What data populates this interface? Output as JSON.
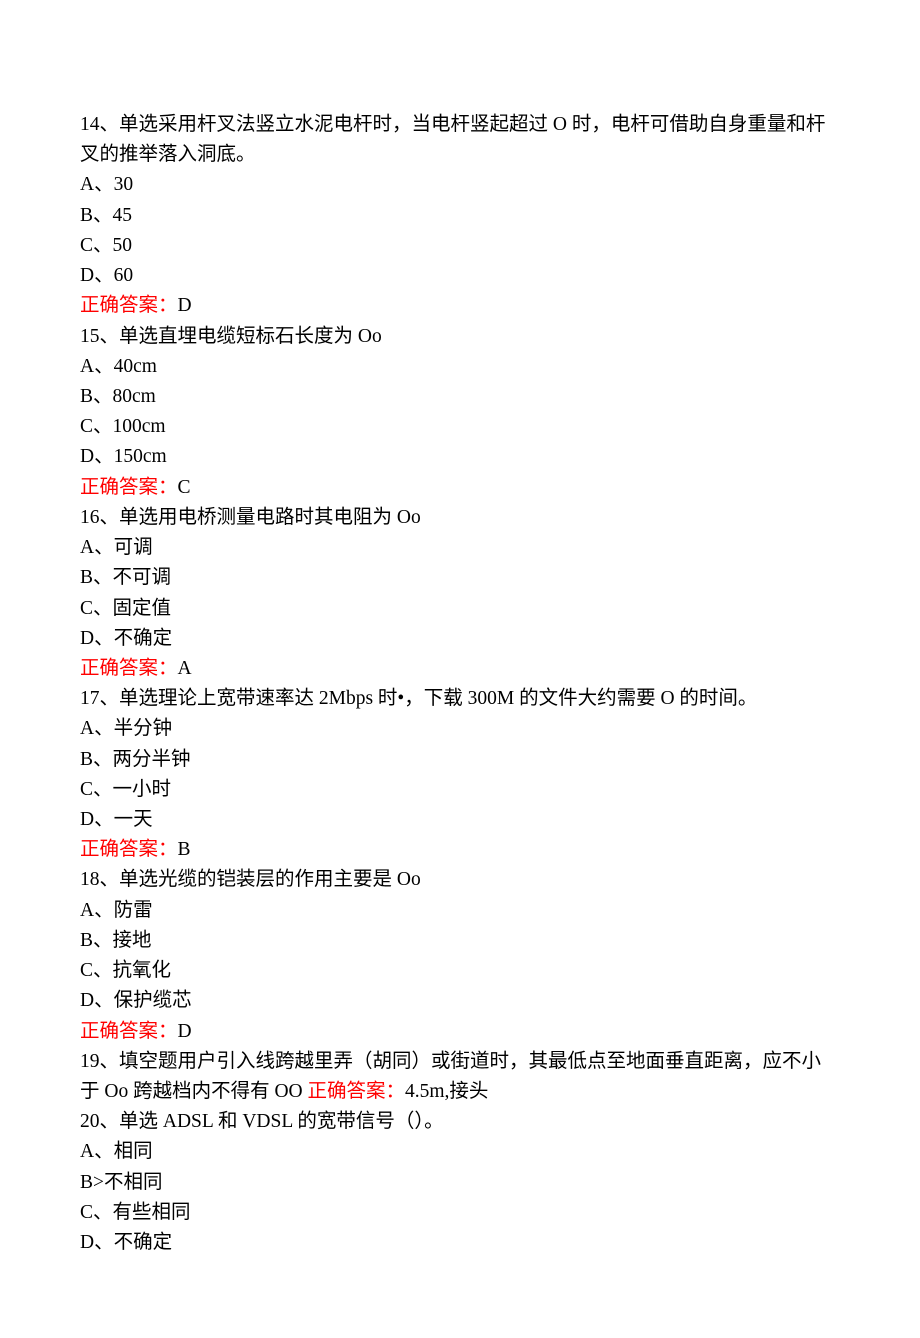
{
  "q14": {
    "text": "14、单选采用杆叉法竖立水泥电杆时，当电杆竖起超过 O 时，电杆可借助自身重量和杆叉的推举落入洞底。",
    "optA": "A、30",
    "optB": "B、45",
    "optC": "C、50",
    "optD": "D、60",
    "ansLabel": "正确答案：",
    "ansVal": "D"
  },
  "q15": {
    "text": "15、单选直埋电缆短标石长度为 Oo",
    "optA": "A、40cm",
    "optB": "B、80cm",
    "optC": "C、100cm",
    "optD": "D、150cm",
    "ansLabel": "正确答案：",
    "ansVal": "C"
  },
  "q16": {
    "text": "16、单选用电桥测量电路时其电阻为 Oo",
    "optA": "A、可调",
    "optB": "B、不可调",
    "optC": "C、固定值",
    "optD": "D、不确定",
    "ansLabel": "正确答案：",
    "ansVal": "A"
  },
  "q17": {
    "text": "17、单选理论上宽带速率达 2Mbps 时•，下载 300M 的文件大约需要 O 的时间。",
    "optA": "A、半分钟",
    "optB": "B、两分半钟",
    "optC": "C、一小时",
    "optD": "D、一天",
    "ansLabel": "正确答案：",
    "ansVal": "B"
  },
  "q18": {
    "text": "18、单选光缆的铠装层的作用主要是 Oo",
    "optA": "A、防雷",
    "optB": "B、接地",
    "optC": "C、抗氧化",
    "optD": "D、保护缆芯",
    "ansLabel": "正确答案：",
    "ansVal": "D"
  },
  "q19": {
    "textPre": "19、填空题用户引入线跨越里弄（胡同）或街道时，其最低点至地面垂直距离，应不小于 Oo 跨越档内不得有 OO ",
    "ansLabel": "正确答案：",
    "ansVal": "4.5m,接头"
  },
  "q20": {
    "text": "20、单选 ADSL 和 VDSL 的宽带信号（）。",
    "optA": "A、相同",
    "optB": "B>不相同",
    "optC": "C、有些相同",
    "optD": "D、不确定"
  }
}
